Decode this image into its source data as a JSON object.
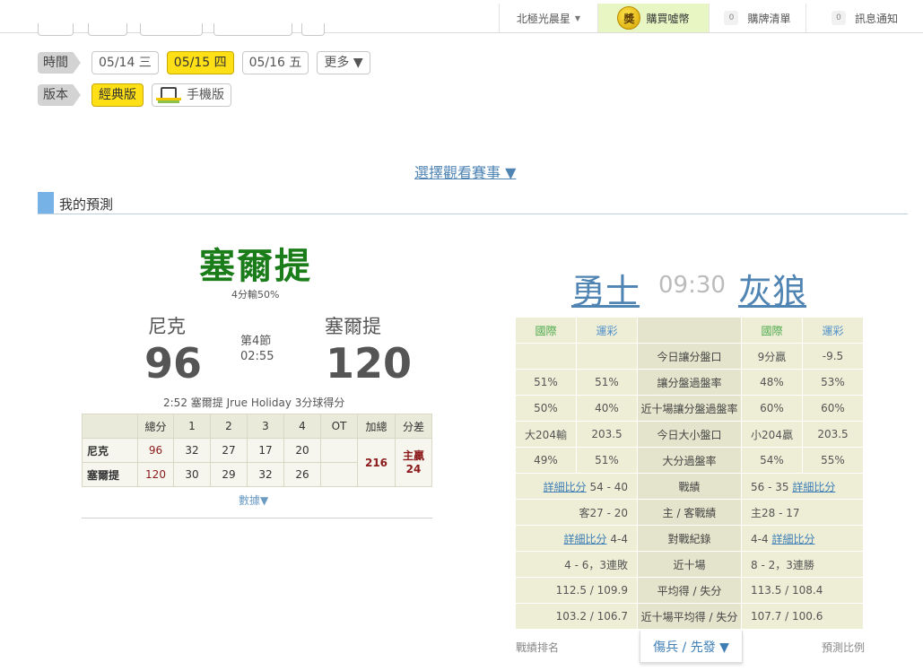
{
  "topbar": {
    "user": "北極光晨星",
    "buy_coin_glyph": "獎",
    "buy": "購買噓幣",
    "cart_count": "0",
    "cart": "購牌清單",
    "notify_count": "0",
    "notify": "訊息通知"
  },
  "filters": {
    "time_tag": "時間",
    "dates": [
      "05/14 三",
      "05/15 四",
      "05/16 五"
    ],
    "more": "更多 ▼",
    "version_tag": "版本",
    "classic": "經典版",
    "mobile": "手機版"
  },
  "select_games": "選擇觀看賽事 ▼",
  "section": {
    "title": "我的預測"
  },
  "prediction": {
    "pick": "塞爾提",
    "pick_sub": "4分輸50%",
    "away_team": "尼克",
    "home_team": "塞爾提",
    "away_score": "96",
    "home_score": "120",
    "period": "第4節",
    "clock": "02:55",
    "event": "2:52 塞爾提 Jrue Holiday 3分球得分",
    "data_link": "數據▼"
  },
  "boxscore": {
    "headers": [
      "",
      "總分",
      "1",
      "2",
      "3",
      "4",
      "OT",
      "加總",
      "分差"
    ],
    "rows": [
      {
        "team": "尼克",
        "total": "96",
        "q": [
          "32",
          "27",
          "17",
          "20"
        ],
        "ot": ""
      },
      {
        "team": "塞爾提",
        "total": "120",
        "q": [
          "30",
          "29",
          "32",
          "26"
        ],
        "ot": ""
      }
    ],
    "sum": "216",
    "diff_label": "主贏",
    "diff": "24"
  },
  "matchup": {
    "left_team": "勇士",
    "time": "09:30",
    "right_team": "灰狼"
  },
  "stats": {
    "hdr": [
      "國際",
      "運彩",
      "國際",
      "運彩"
    ],
    "rows": [
      {
        "a": "",
        "b": "",
        "mid": "今日讓分盤口",
        "c": "9分贏",
        "d": "-9.5"
      },
      {
        "a": "51%",
        "b": "51%",
        "mid": "讓分盤過盤率",
        "c": "48%",
        "d": "53%"
      },
      {
        "a": "50%",
        "b": "40%",
        "mid": "近十場讓分盤過盤率",
        "c": "60%",
        "d": "60%"
      },
      {
        "a": "大204輸",
        "b": "203.5",
        "mid": "今日大小盤口",
        "c": "小204贏",
        "d": "203.5"
      },
      {
        "a": "49%",
        "b": "51%",
        "mid": "大分過盤率",
        "c": "54%",
        "d": "55%"
      }
    ],
    "record_link": "詳細比分",
    "record_l": "54 - 40",
    "record_mid": "戰績",
    "record_r": "56 - 35",
    "homeaway_l": "客27 - 20",
    "homeaway_mid": "主 / 客戰績",
    "homeaway_r": "主28 - 17",
    "h2h_l": "4-4",
    "h2h_mid": "對戰紀錄",
    "h2h_r": "4-4",
    "last10_l": "4 - 6，3連敗",
    "last10_mid": "近十場",
    "last10_r": "8 - 2，3連勝",
    "avg_l": "112.5 / 109.9",
    "avg_mid": "平均得 / 失分",
    "avg_r": "113.5 / 108.4",
    "avg10_l": "103.2 / 106.7",
    "avg10_mid": "近十場平均得 / 失分",
    "avg10_r": "107.7 / 100.6"
  },
  "footer": {
    "left": "戰績排名",
    "tab": "傷兵 / 先發 ▼",
    "right": "預測比例"
  }
}
